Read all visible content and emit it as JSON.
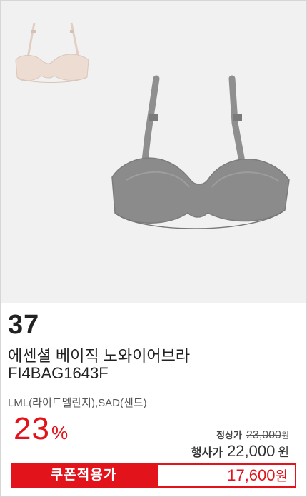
{
  "product": {
    "rank": "37",
    "name": "에센셜 베이직 노와이어브라",
    "code": "FI4BAG1643F",
    "options": "LML(라이트멜란지),SAD(샌드)",
    "discount_rate": "23",
    "discount_symbol": "%",
    "regular_price_label": "정상가",
    "regular_price": "23,000",
    "regular_price_unit": "원",
    "event_price_label": "행사가",
    "event_price": "22,000",
    "event_price_unit": "원",
    "coupon_label": "쿠폰적용가",
    "coupon_price": "17,600",
    "coupon_price_unit": "원"
  },
  "colors": {
    "accent_red": "#e3131b",
    "swatch_beige": "#e9d9cf",
    "swatch_gray": "#8e8e8e"
  },
  "icons": {
    "thumbnail": "beige-bra-thumbnail",
    "main_image": "gray-melange-bra-image"
  }
}
